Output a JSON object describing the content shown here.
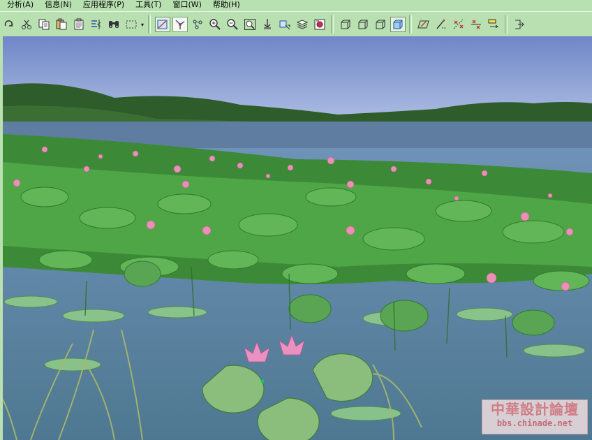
{
  "menu": {
    "items": [
      "分析(A)",
      "信息(N)",
      "应用程序(P)",
      "工具(T)",
      "窗口(W)",
      "帮助(H)"
    ]
  },
  "toolbar": {
    "groups": [
      [
        "redo-icon",
        "cut-icon",
        "copy-icon",
        "paste-icon",
        "clipboard-icon",
        "mirror-icon",
        "find-icon",
        "select-box-icon"
      ],
      [
        "tangent-plane-icon",
        "point-snap-icon",
        "node-edit-icon",
        "zoom-in-icon",
        "zoom-out-icon",
        "zoom-window-icon",
        "pan-icon",
        "pick-face-icon",
        "layer-stack-icon",
        "render-icon"
      ],
      [
        "view-front-icon",
        "view-right-icon",
        "view-iso-icon",
        "view-shaded-icon"
      ],
      [
        "sketch-plane-icon",
        "line-icon",
        "trim-icon",
        "split-icon",
        "dimension-icon"
      ]
    ]
  },
  "colors": {
    "chrome": "#b9e0b1",
    "sky": "#7d9ad0",
    "water": "#5e86a2",
    "leaf": "#3f9a3a",
    "lotus_pink": "#ea8fb6"
  },
  "watermark": {
    "line1": "中華設計論壇",
    "line2": "bbs.chinade.net"
  }
}
